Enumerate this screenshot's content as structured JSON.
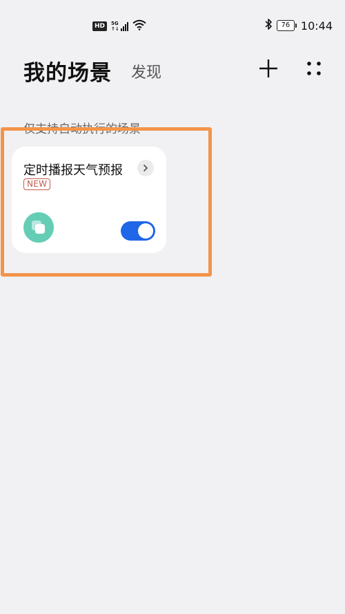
{
  "status_bar": {
    "hd_label": "HD",
    "network_label": "5G",
    "battery_level": "76",
    "time": "10:44",
    "icons": [
      "hd-icon",
      "signal-icon",
      "wifi-icon",
      "bluetooth-icon",
      "battery-icon"
    ]
  },
  "header": {
    "title": "我的场景",
    "discover_tab": "发现",
    "icons": [
      "plus-icon",
      "grid-dots-icon"
    ]
  },
  "section_label": "仅支持自动执行的场景",
  "scene_card": {
    "title": "定时播报天气预报",
    "badge": "NEW",
    "toggle_on": true,
    "icons": [
      "chevron-right-icon",
      "scene-copy-icon"
    ],
    "colors": {
      "icon_bg": "#66cdb5",
      "toggle_on": "#1f66e8",
      "badge": "#c45a4a"
    }
  },
  "highlight_color": "#f39449"
}
